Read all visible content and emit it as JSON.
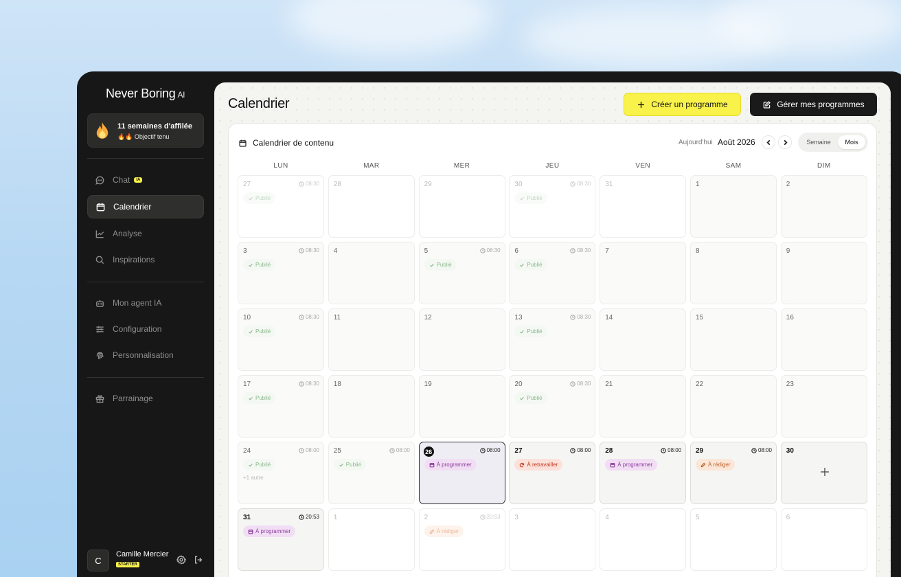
{
  "brand": {
    "name": "Never Boring",
    "suffix": "AI"
  },
  "streak": {
    "title": "11 semaines d'affilée",
    "subtitle": "🔥🔥 Objectif tenu"
  },
  "nav": [
    {
      "label": "Chat",
      "icon": "chat-icon",
      "badge": "IA",
      "active": false
    },
    {
      "label": "Calendrier",
      "icon": "calendar-icon",
      "active": true
    },
    {
      "label": "Analyse",
      "icon": "chart-icon",
      "active": false
    },
    {
      "label": "Inspirations",
      "icon": "search-icon",
      "active": false
    },
    {
      "label": "Mon agent IA",
      "icon": "robot-icon",
      "active": false
    },
    {
      "label": "Configuration",
      "icon": "sliders-icon",
      "active": false
    },
    {
      "label": "Personnalisation",
      "icon": "fingerprint-icon",
      "active": false
    },
    {
      "label": "Parrainage",
      "icon": "gift-icon",
      "active": false
    }
  ],
  "user": {
    "initial": "C",
    "name": "Camille Mercier",
    "plan": "STARTER"
  },
  "header": {
    "title": "Calendrier",
    "create_label": "Créer un programme",
    "manage_label": "Gérer mes programmes"
  },
  "calendar": {
    "title": "Calendrier de contenu",
    "today_label": "Aujourd'hui",
    "month_label": "Août 2026",
    "view_week": "Semaine",
    "view_month": "Mois",
    "days": [
      "LUN",
      "MAR",
      "MER",
      "JEU",
      "VEN",
      "SAM",
      "DIM"
    ],
    "weeks": [
      [
        {
          "d": "27",
          "state": "dim",
          "time": "08:30",
          "pill": "Publié",
          "type": "pub"
        },
        {
          "d": "28",
          "state": "dim"
        },
        {
          "d": "29",
          "state": "dim"
        },
        {
          "d": "30",
          "state": "dim",
          "time": "08:30",
          "pill": "Publié",
          "type": "pub"
        },
        {
          "d": "31",
          "state": "dim"
        },
        {
          "d": "1",
          "state": "past"
        },
        {
          "d": "2",
          "state": "past"
        }
      ],
      [
        {
          "d": "3",
          "state": "past",
          "time": "08:30",
          "pill": "Publié",
          "type": "pub"
        },
        {
          "d": "4",
          "state": "past"
        },
        {
          "d": "5",
          "state": "past",
          "time": "08:30",
          "pill": "Publié",
          "type": "pub"
        },
        {
          "d": "6",
          "state": "past",
          "time": "08:30",
          "pill": "Publié",
          "type": "pub"
        },
        {
          "d": "7",
          "state": "past"
        },
        {
          "d": "8",
          "state": "past"
        },
        {
          "d": "9",
          "state": "past"
        }
      ],
      [
        {
          "d": "10",
          "state": "past",
          "time": "08:30",
          "pill": "Publié",
          "type": "pub"
        },
        {
          "d": "11",
          "state": "past"
        },
        {
          "d": "12",
          "state": "past"
        },
        {
          "d": "13",
          "state": "past",
          "time": "08:30",
          "pill": "Publié",
          "type": "pub"
        },
        {
          "d": "14",
          "state": "past"
        },
        {
          "d": "15",
          "state": "past"
        },
        {
          "d": "16",
          "state": "past"
        }
      ],
      [
        {
          "d": "17",
          "state": "past",
          "time": "08:30",
          "pill": "Publié",
          "type": "pub"
        },
        {
          "d": "18",
          "state": "past"
        },
        {
          "d": "19",
          "state": "past"
        },
        {
          "d": "20",
          "state": "past",
          "time": "08:30",
          "pill": "Publié",
          "type": "pub"
        },
        {
          "d": "21",
          "state": "past"
        },
        {
          "d": "22",
          "state": "past"
        },
        {
          "d": "23",
          "state": "past"
        }
      ],
      [
        {
          "d": "24",
          "state": "past",
          "time": "08:00",
          "pill": "Publié",
          "type": "pub",
          "more": "+1 autre"
        },
        {
          "d": "25",
          "state": "past",
          "time": "08:00",
          "pill": "Publié",
          "type": "pub"
        },
        {
          "d": "26",
          "state": "today",
          "time": "08:00",
          "pill": "À programmer",
          "type": "prog"
        },
        {
          "d": "27",
          "state": "cur",
          "time": "08:00",
          "pill": "À retravailler",
          "type": "retr"
        },
        {
          "d": "28",
          "state": "cur",
          "time": "08:00",
          "pill": "À programmer",
          "type": "prog"
        },
        {
          "d": "29",
          "state": "cur",
          "time": "08:00",
          "pill": "À rédiger",
          "type": "red"
        },
        {
          "d": "30",
          "state": "cur",
          "add": true
        }
      ],
      [
        {
          "d": "31",
          "state": "cur",
          "time": "20:53",
          "pill": "À programmer",
          "type": "prog"
        },
        {
          "d": "1",
          "state": "dim"
        },
        {
          "d": "2",
          "state": "dim",
          "time": "20:53",
          "pill": "À rédiger",
          "type": "red"
        },
        {
          "d": "3",
          "state": "dim"
        },
        {
          "d": "4",
          "state": "dim"
        },
        {
          "d": "5",
          "state": "dim"
        },
        {
          "d": "6",
          "state": "dim"
        }
      ]
    ]
  }
}
